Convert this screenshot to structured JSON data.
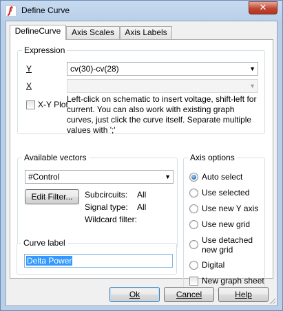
{
  "window": {
    "title": "Define Curve",
    "close_glyph": "✕"
  },
  "tabs": [
    {
      "label": "DefineCurve",
      "active": true
    },
    {
      "label": "Axis Scales",
      "active": false
    },
    {
      "label": "Axis Labels",
      "active": false
    }
  ],
  "expression": {
    "group_label": "Expression",
    "y_label": "Y",
    "y_value": "cv(30)-cv(28)",
    "x_label": "X",
    "x_value": "",
    "xy_plot_label": "X-Y Plot",
    "xy_plot_checked": false,
    "help_text": "Left-click on schematic to insert voltage, shift-left for current. You can also work with existing graph curves, just click the curve itself. Separate multiple values with ';'"
  },
  "available_vectors": {
    "group_label": "Available vectors",
    "selected": "#Control",
    "edit_filter_label": "Edit Filter...",
    "subcircuits_label": "Subcircuits:",
    "subcircuits_value": "All",
    "signal_type_label": "Signal type:",
    "signal_type_value": "All",
    "wildcard_label": "Wildcard filter:",
    "wildcard_value": ""
  },
  "curve_label": {
    "group_label": "Curve label",
    "value": "Delta Power"
  },
  "axis_options": {
    "group_label": "Axis options",
    "radios": [
      {
        "label": "Auto select",
        "checked": true
      },
      {
        "label": "Use selected",
        "checked": false
      },
      {
        "label": "Use new Y axis",
        "checked": false
      },
      {
        "label": "Use new grid",
        "checked": false
      },
      {
        "label": "Use detached new grid",
        "checked": false
      },
      {
        "label": "Digital",
        "checked": false
      }
    ],
    "new_graph_sheet_label": "New graph sheet",
    "new_graph_sheet_checked": false
  },
  "buttons": {
    "ok": "Ok",
    "cancel": "Cancel",
    "help": "Help"
  },
  "colors": {
    "accent": "#3399ff",
    "title_gradient": "#b9cfe8",
    "close": "#c4462f"
  }
}
